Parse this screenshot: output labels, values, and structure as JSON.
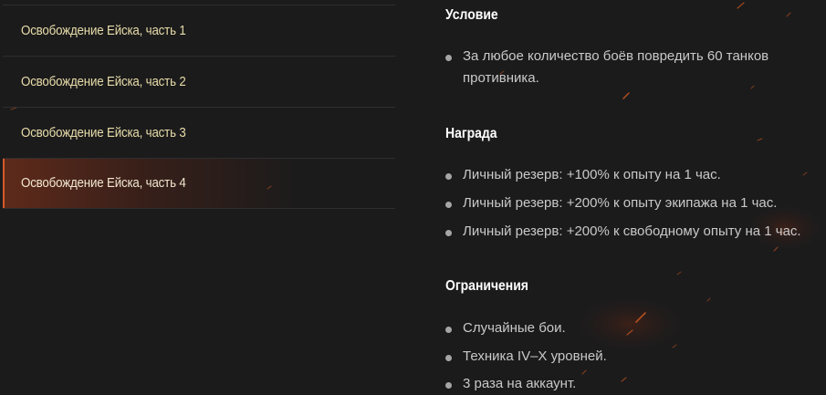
{
  "missions": [
    {
      "label": "Освобождение Ейска, часть 1",
      "active": false
    },
    {
      "label": "Освобождение Ейска, часть 2",
      "active": false
    },
    {
      "label": "Освобождение Ейска, часть 3",
      "active": false
    },
    {
      "label": "Освобождение Ейска, часть 4",
      "active": true
    }
  ],
  "condition": {
    "title": "Условие",
    "items": [
      "За любое количество боёв повредить 60 танков противника."
    ]
  },
  "reward": {
    "title": "Награда",
    "items": [
      "Личный резерв: +100% к опыту на 1 час.",
      "Личный резерв: +200% к опыту экипажа на 1 час.",
      "Личный резерв: +200% к свободному опыту на 1 час."
    ]
  },
  "restrictions": {
    "title": "Ограничения",
    "items": [
      "Случайные бои.",
      "Техника IV–X уровней.",
      "3 раза на аккаунт."
    ]
  },
  "colors": {
    "background": "#1b1b1c",
    "accent": "#d45a2a",
    "mission_text": "#e7dca8"
  }
}
